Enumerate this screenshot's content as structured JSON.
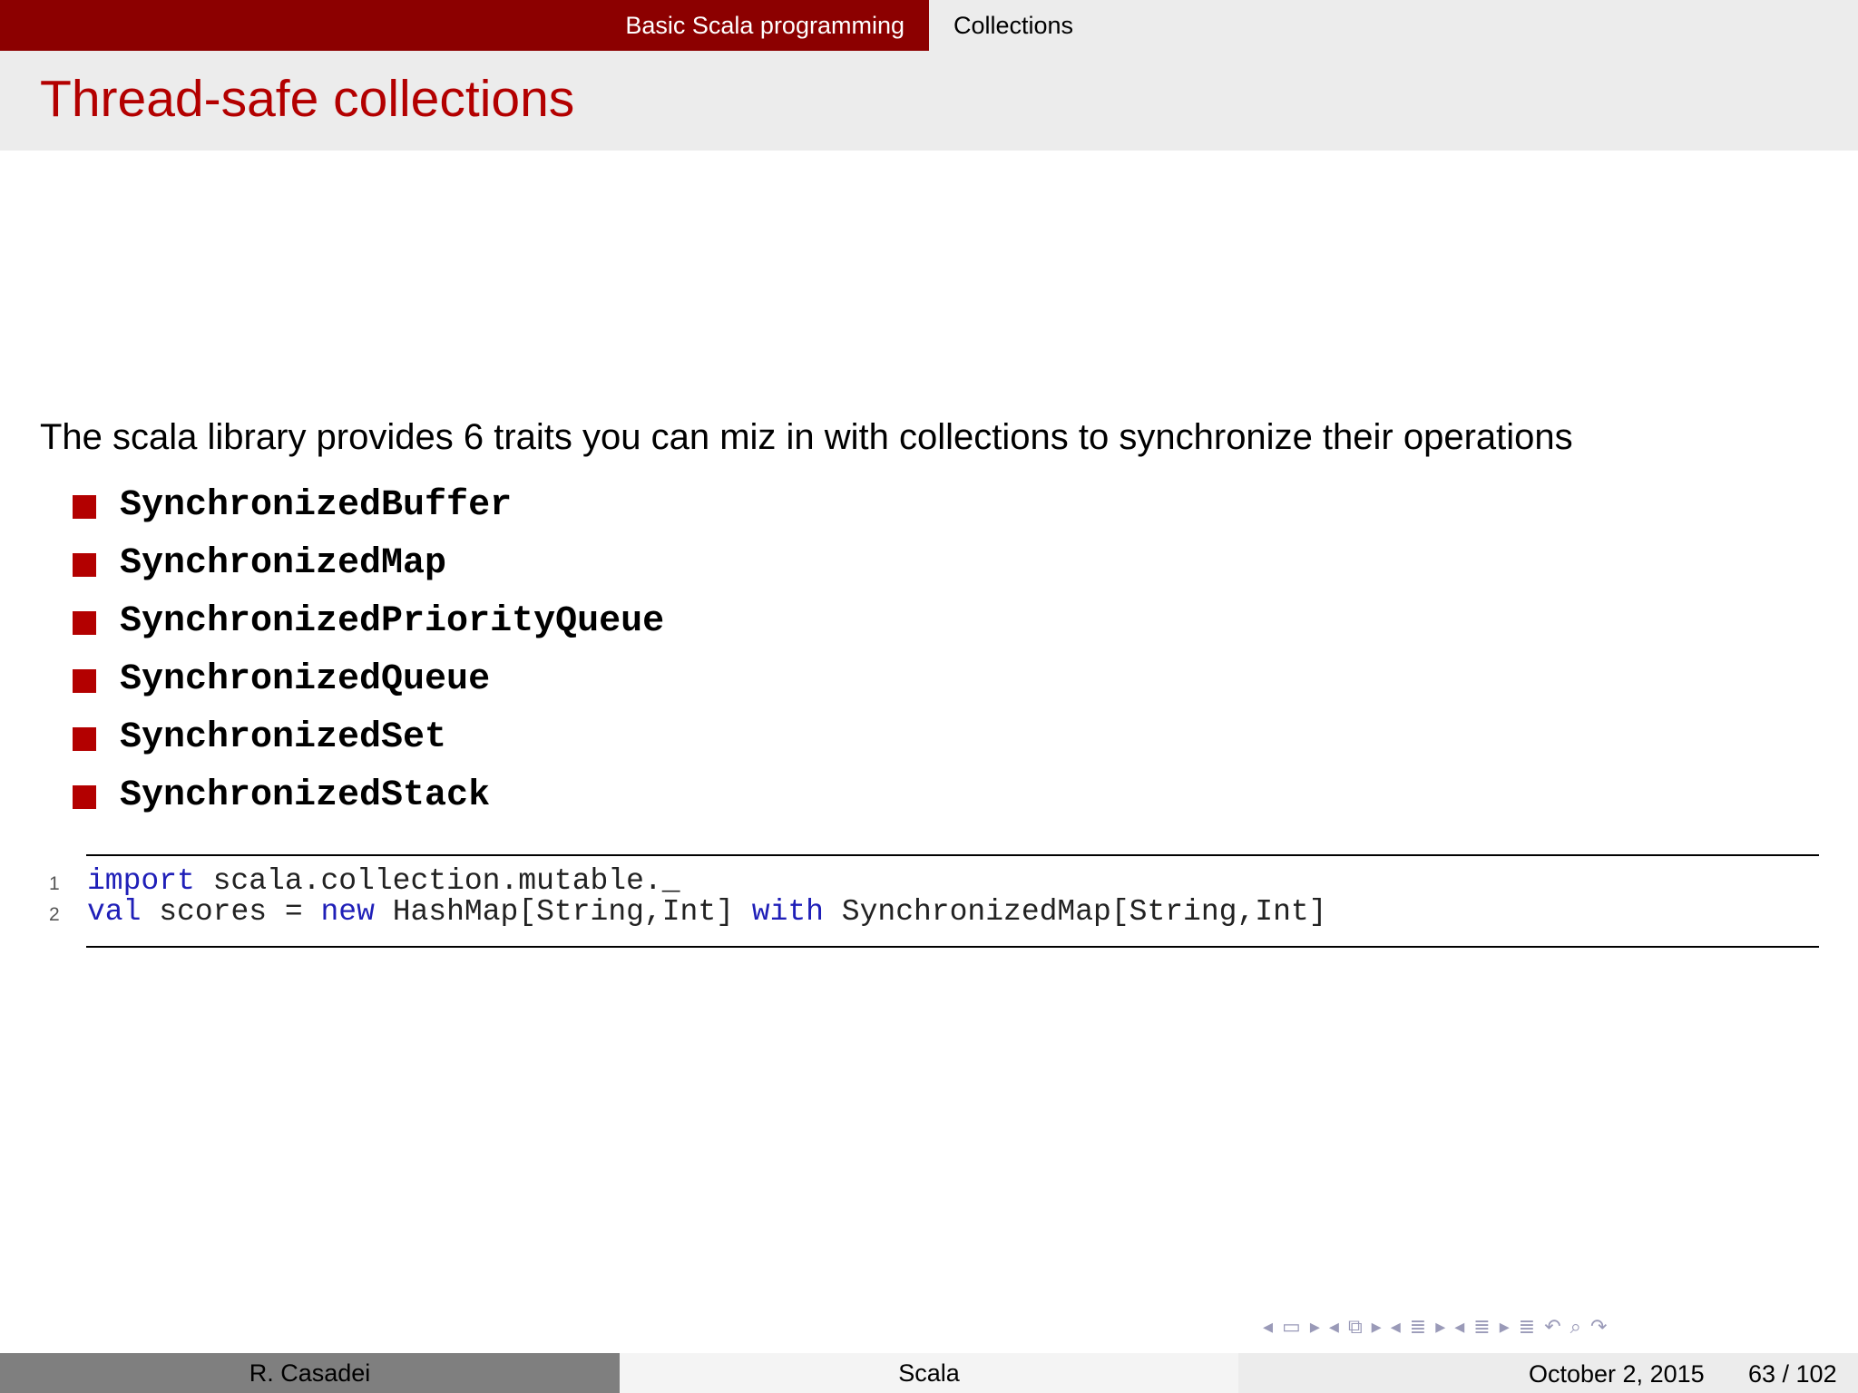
{
  "nav": {
    "section": "Basic Scala programming",
    "subsection": "Collections"
  },
  "frame": {
    "title": "Thread-safe collections"
  },
  "content": {
    "intro": "The scala library provides 6 traits you can miz in with collections to synchronize their operations",
    "items": [
      "SynchronizedBuffer",
      "SynchronizedMap",
      "SynchronizedPriorityQueue",
      "SynchronizedQueue",
      "SynchronizedSet",
      "SynchronizedStack"
    ]
  },
  "code": {
    "lines": [
      {
        "number": "1",
        "tokens": [
          {
            "text": "import",
            "kind": "keyword"
          },
          {
            "text": " scala.collection.mutable._",
            "kind": "plain"
          }
        ]
      },
      {
        "number": "2",
        "tokens": [
          {
            "text": "val",
            "kind": "keyword"
          },
          {
            "text": " scores = ",
            "kind": "plain"
          },
          {
            "text": "new",
            "kind": "keyword"
          },
          {
            "text": " HashMap[String,Int] ",
            "kind": "plain"
          },
          {
            "text": "with",
            "kind": "keyword"
          },
          {
            "text": " SynchronizedMap[String,Int]",
            "kind": "plain"
          }
        ]
      }
    ]
  },
  "navigation_icons": [
    "prev-arrow-icon",
    "frame-icon",
    "next-arrow-icon",
    "prev-arrow-icon",
    "subsection-icon",
    "next-arrow-icon",
    "prev-arrow-icon",
    "section-icon",
    "next-arrow-icon",
    "prev-arrow-icon",
    "outline-icon",
    "next-arrow-icon",
    "appendix-icon",
    "back-icon",
    "search-icon",
    "forward-icon"
  ],
  "footer": {
    "author": "R. Casadei",
    "short_title": "Scala",
    "date": "October 2, 2015",
    "page": "63 / 102"
  },
  "colors": {
    "theme_dark_red": "#8c0000",
    "title_red": "#b30000",
    "bullet_red": "#b30000",
    "keyword_blue": "#1f1fb8",
    "footer_gray": "#7f7f7f"
  }
}
